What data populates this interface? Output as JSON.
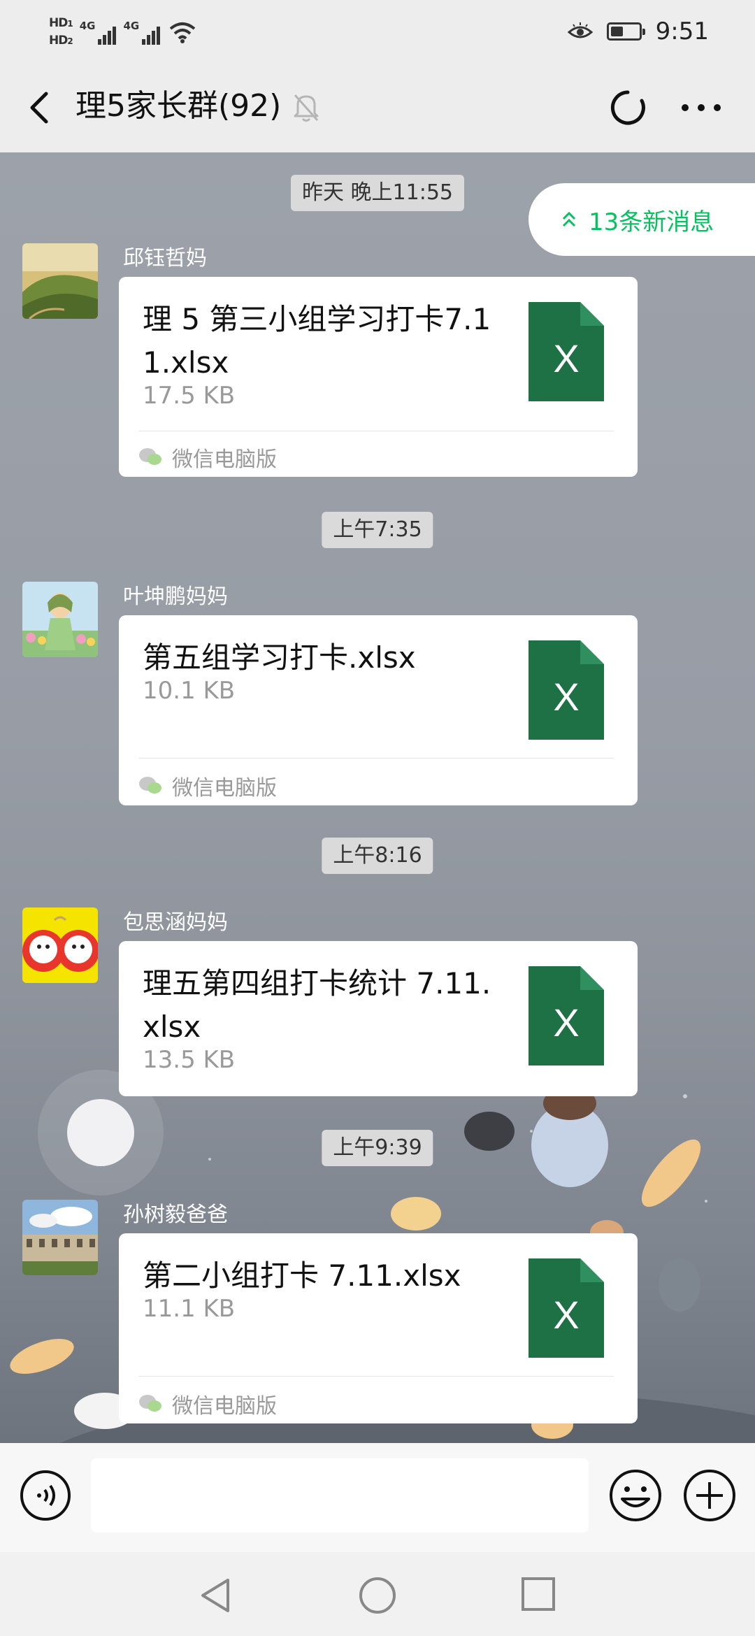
{
  "status_bar": {
    "hd1": "HD",
    "hd1_sub": "1",
    "hd2": "HD",
    "hd2_sub": "2",
    "net1": "4G",
    "net2": "4G",
    "time": "9:51",
    "battery_level": 0.45
  },
  "header": {
    "title": "理5家长群(92)"
  },
  "new_messages": {
    "label": "13条新消息"
  },
  "chat": {
    "timestamps": [
      "昨天 晚上11:55",
      "上午7:35",
      "上午8:16",
      "上午9:39"
    ],
    "messages": [
      {
        "sender": "邱钰哲妈",
        "file_name": "理 5 第三小组学习打卡7.11.xlsx",
        "file_size": "17.5 KB",
        "source": "微信电脑版",
        "file_icon_letter": "X"
      },
      {
        "sender": "叶坤鹏妈妈",
        "file_name": "第五组学习打卡.xlsx",
        "file_size": "10.1 KB",
        "source": "微信电脑版",
        "file_icon_letter": "X"
      },
      {
        "sender": "包思涵妈妈",
        "file_name": "理五第四组打卡统计 7.11.xlsx",
        "file_size": "13.5 KB",
        "source": "",
        "file_icon_letter": "X"
      },
      {
        "sender": "孙树毅爸爸",
        "file_name": "第二小组打卡 7.11.xlsx",
        "file_size": "11.1 KB",
        "source": "微信电脑版",
        "file_icon_letter": "X"
      }
    ]
  },
  "input_bar": {
    "placeholder": ""
  },
  "colors": {
    "accent_green": "#07c160",
    "excel_green": "#1e7145",
    "chat_bg": "#979ca5"
  }
}
